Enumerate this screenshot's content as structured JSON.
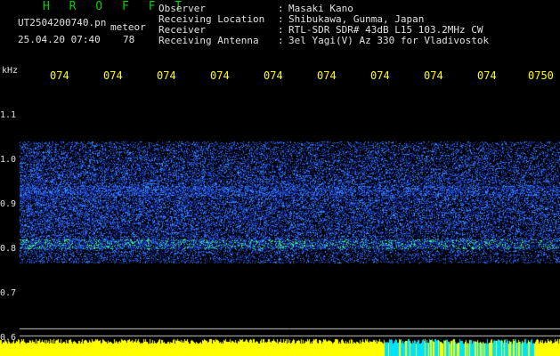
{
  "header": {
    "brand": "H R O F F T",
    "filename": "UT2504200740.pn",
    "filename_suffix": "meteor",
    "datetime": "25.04.20 07:40",
    "count": "78"
  },
  "station": [
    {
      "label": "Observer",
      "value": "Masaki Kano"
    },
    {
      "label": "Receiving Location",
      "value": "Shibukawa, Gunma, Japan"
    },
    {
      "label": "Receiver",
      "value": "RTL-SDR SDR# 43dB L15 103.2MHz CW"
    },
    {
      "label": "Receiving Antenna",
      "value": "3el Yagi(V) Az 330 for Vladivostok"
    }
  ],
  "axis": {
    "unit": "kHz",
    "time_labels": [
      "074",
      "074",
      "074",
      "074",
      "074",
      "074",
      "074",
      "074",
      "074",
      "0750"
    ],
    "freq_labels": [
      "1.1",
      "1.0",
      "0.9",
      "0.8",
      "0.7",
      "0.6"
    ]
  },
  "colors": {
    "background": "#000000",
    "text": "#e0e0e0",
    "time_label": "#ffff00",
    "brand": "#00d000",
    "signal_low": "#0a1a7a",
    "signal_mid": "#2f7fff",
    "signal_high": "#40ff80",
    "bar": "#ffff00",
    "bar_alt": "#00e0ff"
  }
}
